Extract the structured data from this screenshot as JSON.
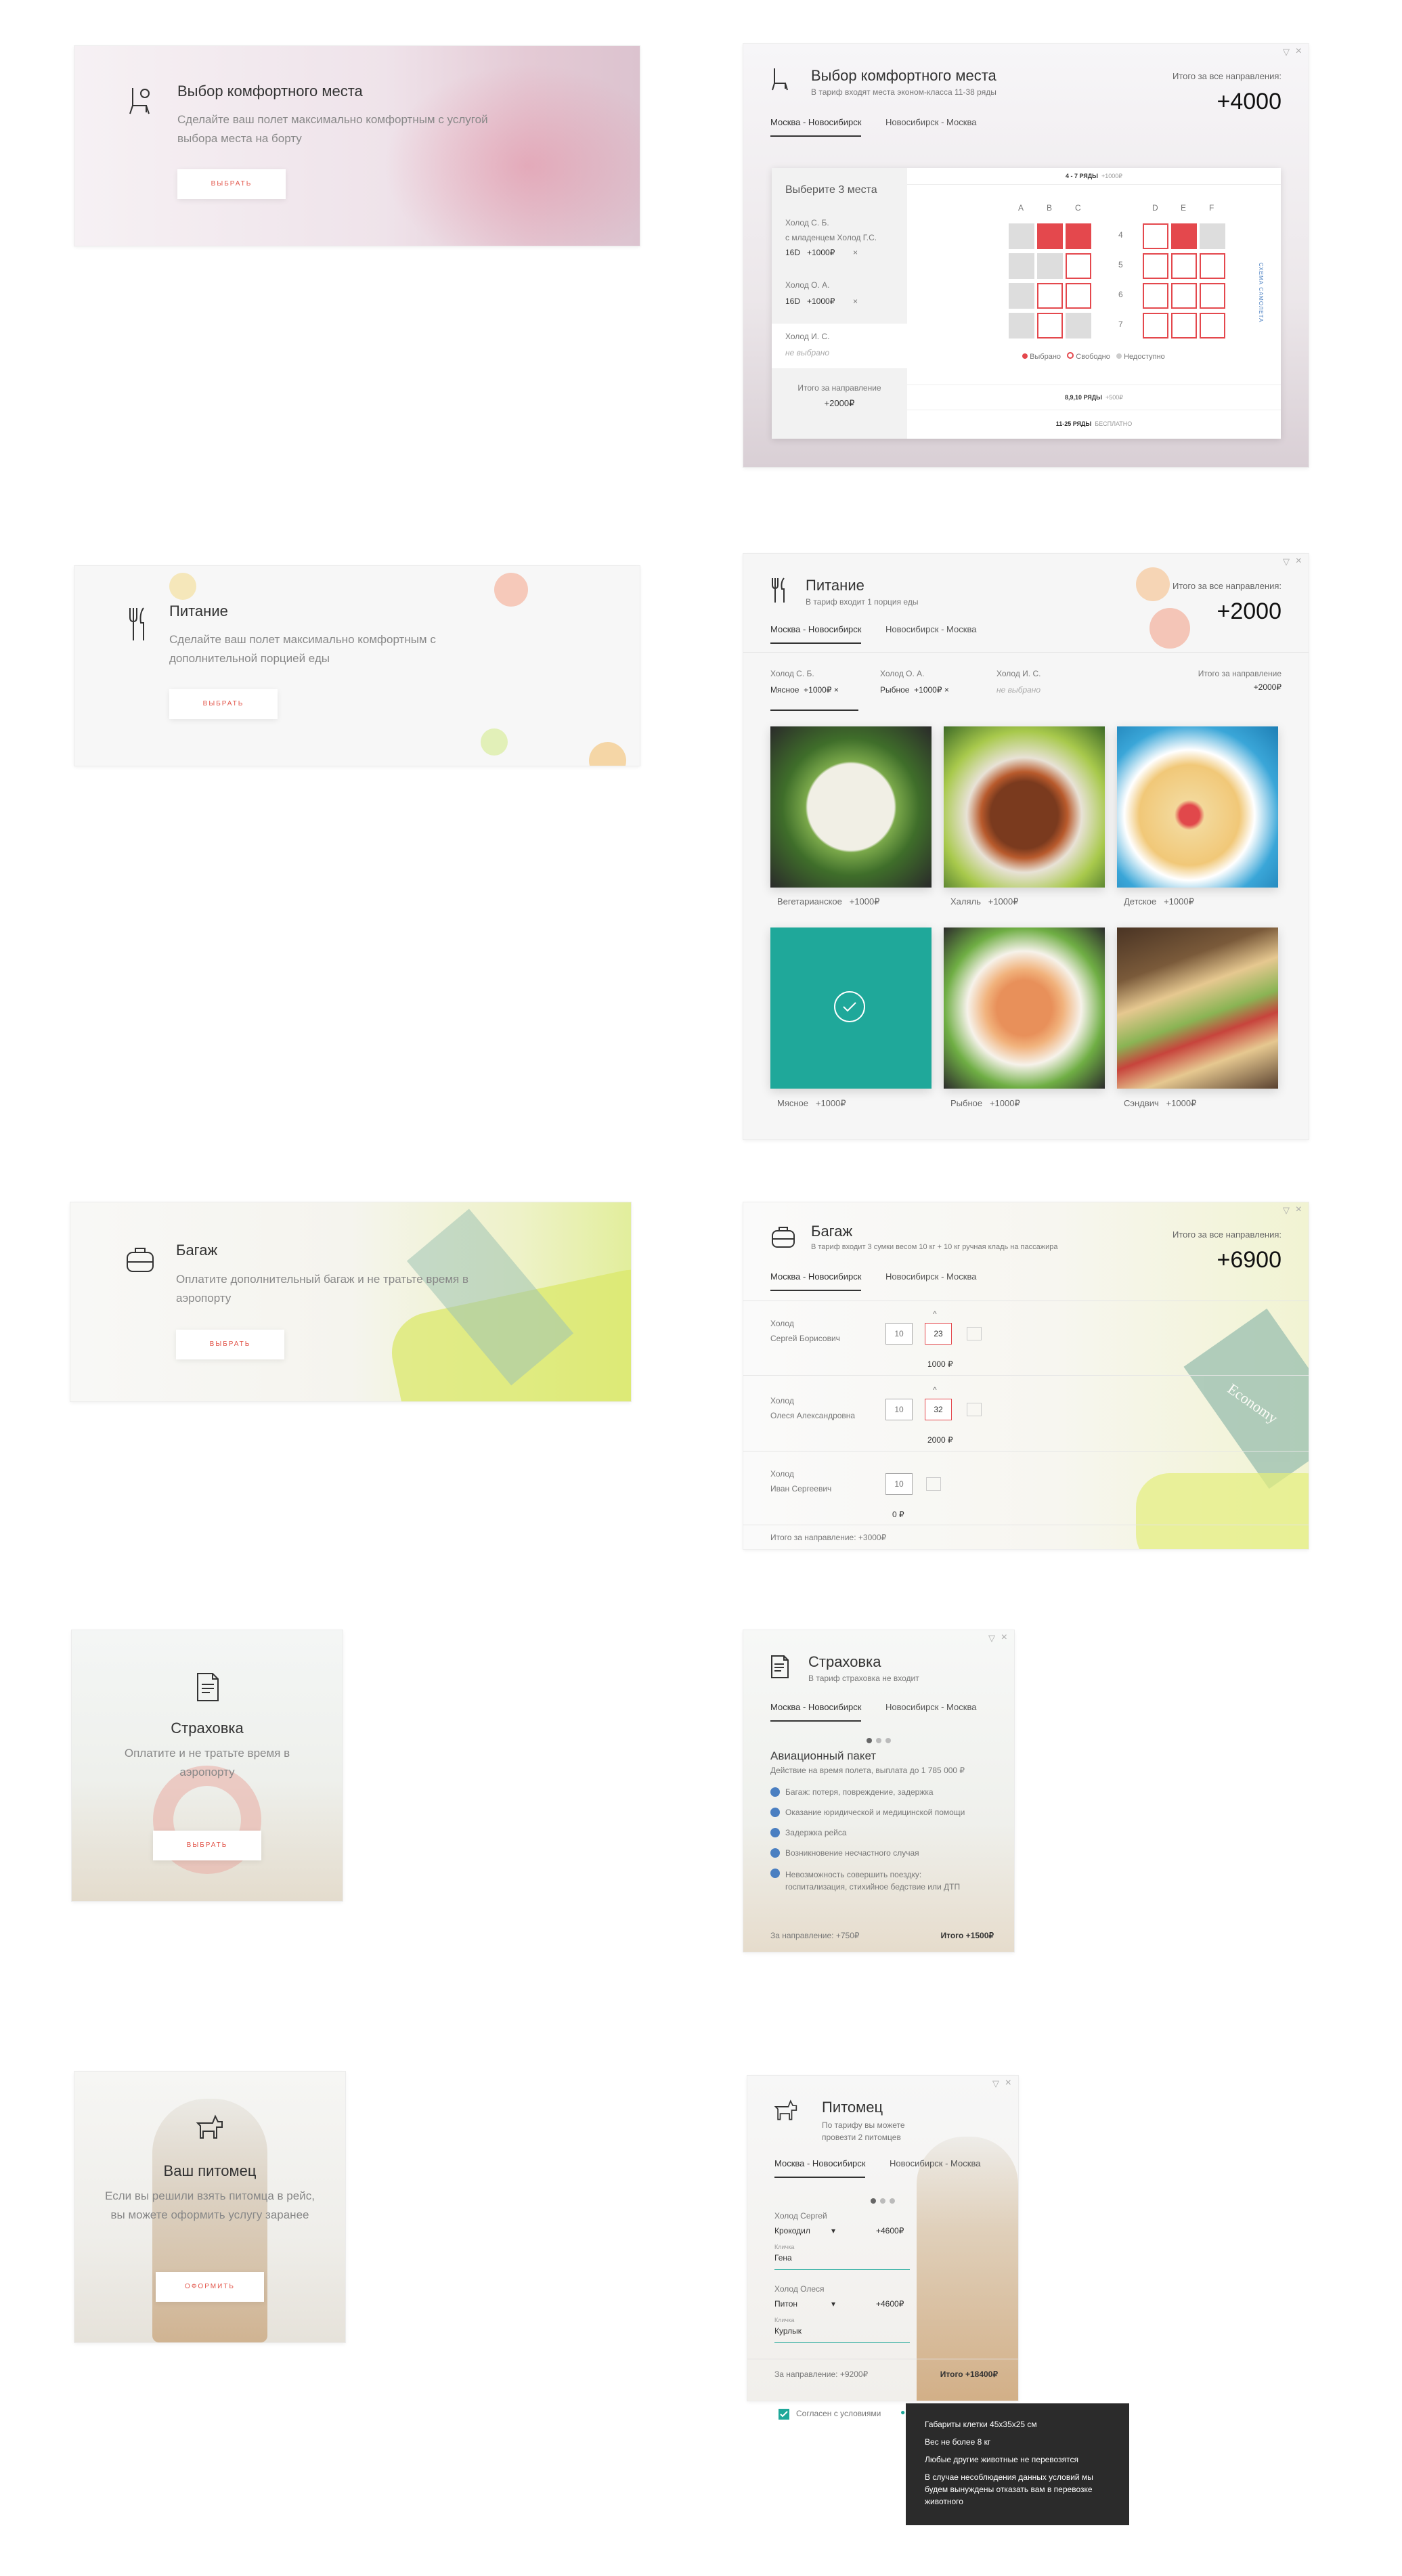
{
  "seat": {
    "promo": {
      "title": "Выбор комфортного места",
      "desc": "Сделайте ваш полет максимально комфортным с услугой выбора места на борту",
      "button": "ВЫБРАТЬ"
    },
    "panel": {
      "title": "Выбор комфортного места",
      "subtitle": "В тариф входят места эконом-класса 11-38 ряды",
      "total_label": "Итого за все направления:",
      "total_value": "+4000",
      "tabs": [
        "Москва - Новосибирск",
        "Новосибирск - Москва"
      ],
      "choose_label": "Выберите 3 места",
      "passengers": [
        {
          "name": "Холод С. Б.",
          "note": "с младенцем Холод Г.С.",
          "seat": "16D",
          "price": "+1000₽"
        },
        {
          "name": "Холод О. А.",
          "note": "",
          "seat": "16D",
          "price": "+1000₽"
        },
        {
          "name": "Холод И. С.",
          "note": "не выбрано",
          "seat": "",
          "price": ""
        }
      ],
      "direction_total_label": "Итого за направление",
      "direction_total_value": "+2000₽",
      "section_top": {
        "rows": "4 - 7 РЯДЫ",
        "price": "+1000₽"
      },
      "columns_left": [
        "A",
        "B",
        "C"
      ],
      "columns_right": [
        "D",
        "E",
        "F"
      ],
      "rows": [
        "4",
        "5",
        "6",
        "7"
      ],
      "scheme_label": "СХЕМА САМОЛЕТА",
      "legend": [
        "Выбрано",
        "Свободно",
        "Недоступно"
      ],
      "section_mid": {
        "rows": "8,9,10 РЯДЫ",
        "price": "+500₽"
      },
      "section_bot": {
        "rows": "11-25 РЯДЫ",
        "price": "БЕСПЛАТНО"
      }
    }
  },
  "food": {
    "promo": {
      "title": "Питание",
      "desc": "Сделайте ваш полет максимально комфортным с дополнительной порцией еды",
      "button": "ВЫБРАТЬ"
    },
    "panel": {
      "title": "Питание",
      "subtitle": "В тариф входит 1 порция еды",
      "total_label": "Итого за все направления:",
      "total_value": "+2000",
      "tabs": [
        "Москва - Новосибирск",
        "Новосибирск - Москва"
      ],
      "passengers": [
        {
          "name": "Холод С. Б.",
          "meal": "Мясное",
          "price": "+1000₽"
        },
        {
          "name": "Холод О. А.",
          "meal": "Рыбное",
          "price": "+1000₽"
        },
        {
          "name": "Холод И. С.",
          "meal": "не выбрано",
          "price": ""
        }
      ],
      "direction_total_label": "Итого за направление",
      "direction_total_value": "+2000₽",
      "items": [
        {
          "name": "Вегетарианское",
          "price": "+1000₽"
        },
        {
          "name": "Халяль",
          "price": "+1000₽"
        },
        {
          "name": "Детское",
          "price": "+1000₽"
        },
        {
          "name": "Мясное",
          "price": "+1000₽"
        },
        {
          "name": "Рыбное",
          "price": "+1000₽"
        },
        {
          "name": "Сэндвич",
          "price": "+1000₽"
        }
      ]
    }
  },
  "baggage": {
    "promo": {
      "title": "Багаж",
      "desc": "Оплатите дополнительный багаж и не тратьте время в аэропорту",
      "button": "ВЫБРАТЬ"
    },
    "panel": {
      "title": "Багаж",
      "subtitle": "В тариф входит 3 сумки весом 10 кг + 10 кг ручная кладь на пассажира",
      "total_label": "Итого за все направления:",
      "total_value": "+6900",
      "tabs": [
        "Москва - Новосибирск",
        "Новосибирск - Москва"
      ],
      "sign_text": "Economy",
      "passengers": [
        {
          "last": "Холод",
          "first": "Сергей Борисович",
          "bags": [
            "10",
            "23"
          ],
          "price": "1000 ₽"
        },
        {
          "last": "Холод",
          "first": "Олеся Александровна",
          "bags": [
            "10",
            "32"
          ],
          "price": "2000 ₽"
        },
        {
          "last": "Холод",
          "first": "Иван Сергеевич",
          "bags": [
            "10"
          ],
          "price": "0 ₽"
        }
      ],
      "direction_total": "Итого за направление: +3000₽"
    }
  },
  "insurance": {
    "promo": {
      "title": "Страховка",
      "desc": "Оплатите и не тратьте время в аэропорту",
      "button": "ВЫБРАТЬ"
    },
    "panel": {
      "title": "Страховка",
      "subtitle": "В тариф страховка не входит",
      "tabs": [
        "Москва - Новосибирск",
        "Новосибирск - Москва"
      ],
      "package_title": "Авиационный пакет",
      "package_desc": "Действие на время полета, выплата до 1 785 000 ₽",
      "features": [
        "Багаж: потеря, повреждение, задержка",
        "Оказание юридической и медицинской помощи",
        "Задержка рейса",
        "Возникновение несчастного случая",
        "Невозможность совершить поездку: госпитализация, стихийное бедствие или ДТП"
      ],
      "direction_total": "За направление: +750₽",
      "total": "Итого +1500₽"
    }
  },
  "pet": {
    "promo": {
      "title": "Ваш питомец",
      "desc": "Если вы решили взять питомца в рейс, вы можете оформить услугу заранее",
      "button": "ОФОРМИТЬ"
    },
    "panel": {
      "title": "Питомец",
      "subtitle": "По тарифу вы можете провезти 2 питомцев",
      "tabs": [
        "Москва - Новосибирск",
        "Новосибирск - Москва"
      ],
      "passengers": [
        {
          "name": "Холод Сергей",
          "animal": "Крокодил",
          "price": "+4600₽",
          "nick_label": "Кличка",
          "nick": "Гена"
        },
        {
          "name": "Холод Олеся",
          "animal": "Питон",
          "price": "+4600₽",
          "nick_label": "Кличка",
          "nick": "Курлык"
        }
      ],
      "direction_total": "За направление: +9200₽",
      "total": "Итого +18400₽",
      "agree": "Согласен с условиями",
      "tooltip": [
        "Габариты клетки 45х35х25 см",
        "Вес не более 8 кг",
        "Любые другие животные не перевозятся",
        "В случае несоблюдения данных условий мы будем вынуждены отказать вам в перевозке животного"
      ]
    }
  },
  "controls": {
    "collapse": "▽",
    "close": "×"
  },
  "colors": {
    "accent": "#e4484d",
    "button_text": "#e2554a",
    "teal": "#1fa89a",
    "check": "#4a7fc1",
    "tooltip_bg": "#2b2b2b"
  }
}
